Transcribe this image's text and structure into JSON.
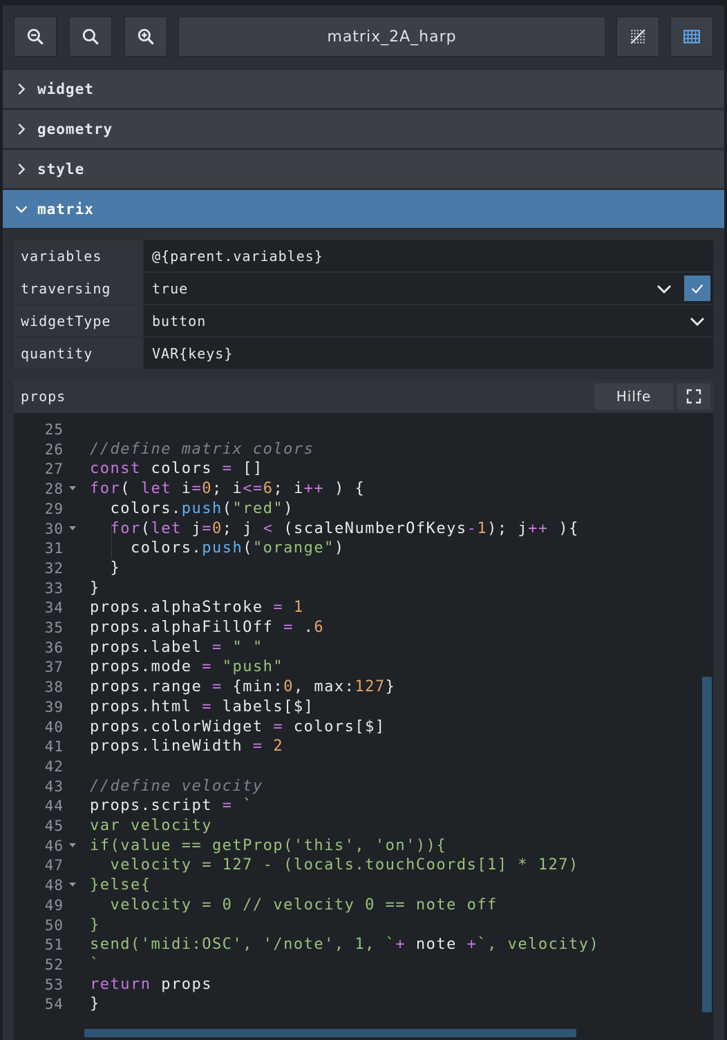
{
  "toolbar": {
    "title": "matrix_2A_harp",
    "zoom_out_icon": "zoom-out-icon",
    "zoom_reset_icon": "zoom-reset-icon",
    "zoom_in_icon": "zoom-in-icon",
    "grid_toggle_icon": "dotted-grid-icon",
    "layout_icon": "table-grid-icon"
  },
  "sections": [
    {
      "label": "widget",
      "expanded": false
    },
    {
      "label": "geometry",
      "expanded": false
    },
    {
      "label": "style",
      "expanded": false
    },
    {
      "label": "matrix",
      "expanded": true
    }
  ],
  "matrix": {
    "properties": [
      {
        "key": "variables",
        "value": "@{parent.variables}"
      },
      {
        "key": "traversing",
        "value": "true"
      },
      {
        "key": "widgetType",
        "value": "button"
      },
      {
        "key": "quantity",
        "value": "VAR{keys}"
      }
    ],
    "props_label": "props",
    "help_label": "Hilfe"
  },
  "colors": {
    "accent": "#4a7aa8",
    "keyword": "#c678dd",
    "number": "#e5a564",
    "string": "#98c379",
    "function": "#61afef",
    "comment": "#7d838c"
  },
  "code": {
    "lines": [
      {
        "n": "25",
        "text": ""
      },
      {
        "n": "26",
        "text": "//define matrix colors"
      },
      {
        "n": "27",
        "text": "const colors = []"
      },
      {
        "n": "28",
        "text": "for( let i=0; i<=6; i++ ) {"
      },
      {
        "n": "29",
        "text": "  colors.push(\"red\")"
      },
      {
        "n": "30",
        "text": "  for(let j=0; j < (scaleNumberOfKeys-1); j++ ){"
      },
      {
        "n": "31",
        "text": "    colors.push(\"orange\")"
      },
      {
        "n": "32",
        "text": "  }"
      },
      {
        "n": "33",
        "text": "}"
      },
      {
        "n": "34",
        "text": "props.alphaStroke = 1"
      },
      {
        "n": "35",
        "text": "props.alphaFillOff = .6"
      },
      {
        "n": "36",
        "text": "props.label = \" \""
      },
      {
        "n": "37",
        "text": "props.mode = \"push\""
      },
      {
        "n": "38",
        "text": "props.range = {min:0, max:127}"
      },
      {
        "n": "39",
        "text": "props.html = labels[$]"
      },
      {
        "n": "40",
        "text": "props.colorWidget = colors[$]"
      },
      {
        "n": "41",
        "text": "props.lineWidth = 2"
      },
      {
        "n": "42",
        "text": ""
      },
      {
        "n": "43",
        "text": "//define velocity"
      },
      {
        "n": "44",
        "text": "props.script = `"
      },
      {
        "n": "45",
        "text": "var velocity"
      },
      {
        "n": "46",
        "text": "if(value == getProp('this', 'on')){"
      },
      {
        "n": "47",
        "text": "  velocity = 127 - (locals.touchCoords[1] * 127)"
      },
      {
        "n": "48",
        "text": "}else{"
      },
      {
        "n": "49",
        "text": "  velocity = 0 // velocity 0 == note off"
      },
      {
        "n": "50",
        "text": "}"
      },
      {
        "n": "51",
        "text": "send('midi:OSC', '/note', 1, `+ note +`, velocity)"
      },
      {
        "n": "52",
        "text": "`"
      },
      {
        "n": "53",
        "text": "return props"
      },
      {
        "n": "54",
        "text": "}"
      }
    ]
  }
}
